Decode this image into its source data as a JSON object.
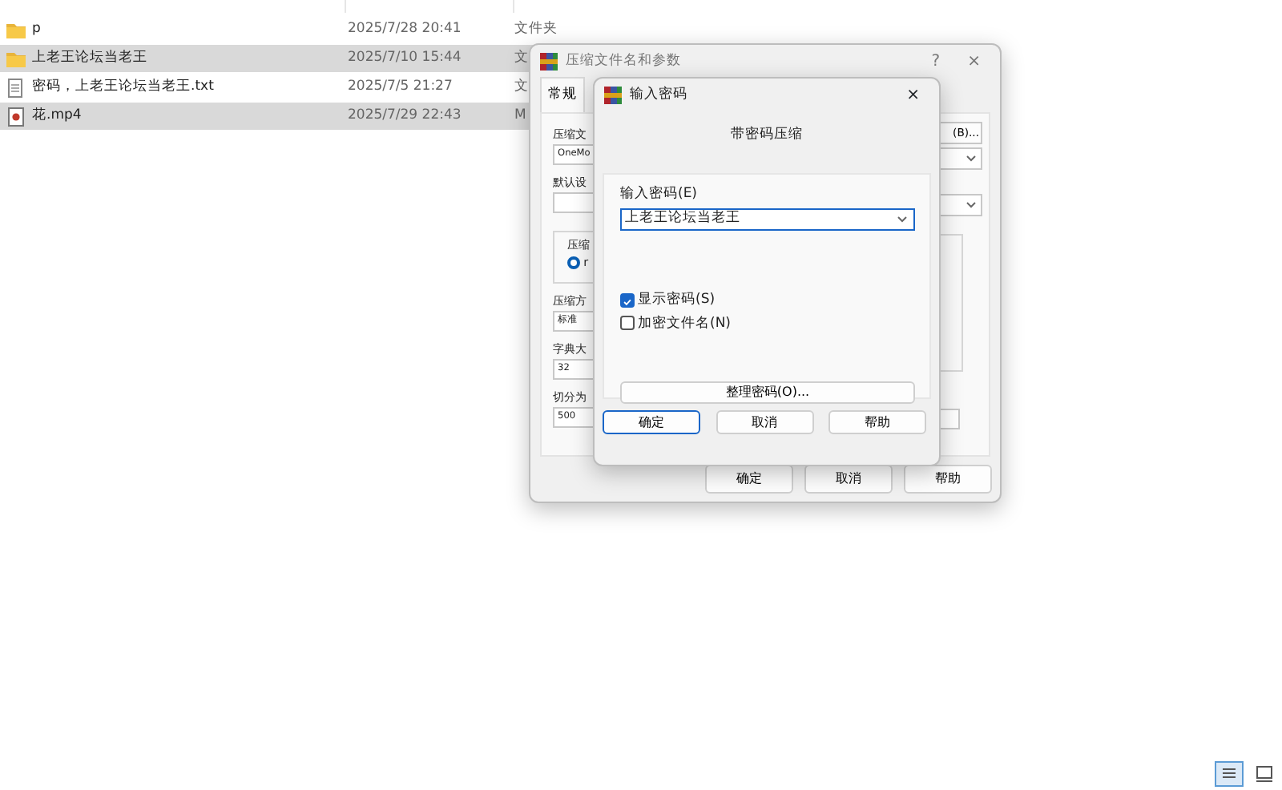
{
  "files": [
    {
      "name": "p",
      "date": "2025/7/28 20:41",
      "type": "文件夹",
      "kind": "folder",
      "selected": false
    },
    {
      "name": "上老王论坛当老王",
      "date": "2025/7/10 15:44",
      "type": "文",
      "kind": "folder",
      "selected": true
    },
    {
      "name": "密码，上老王论坛当老王.txt",
      "date": "2025/7/5 21:27",
      "type": "文",
      "kind": "text",
      "selected": false
    },
    {
      "name": "花.mp4",
      "date": "2025/7/29 22:43",
      "type": "M",
      "kind": "video",
      "selected": true
    }
  ],
  "archive_dialog": {
    "title": "压缩文件名和参数",
    "help": "?",
    "close": "×",
    "tabs": [
      {
        "label": "常规",
        "selected": true
      }
    ],
    "left": [
      {
        "kind": "label",
        "text": "压缩文"
      },
      {
        "kind": "field",
        "text": "OneMo"
      },
      {
        "kind": "label",
        "text": "默认设"
      },
      {
        "kind": "field"
      },
      {
        "kind": "group",
        "text": "压缩",
        "option": "r",
        "checked": true
      },
      {
        "kind": "label",
        "text": "压缩方"
      },
      {
        "kind": "field",
        "text": "标准"
      },
      {
        "kind": "label",
        "text": "字典大"
      },
      {
        "kind": "field",
        "text": "32"
      },
      {
        "kind": "label",
        "text": "切分为"
      },
      {
        "kind": "field",
        "text": "500"
      }
    ],
    "right": [
      {
        "kind": "button",
        "text": "(B)..."
      },
      {
        "kind": "combo"
      },
      {
        "kind": "combo"
      },
      {
        "kind": "group"
      },
      {
        "kind": "field"
      }
    ],
    "buttons": [
      {
        "label": "确定",
        "default": false
      },
      {
        "label": "取消",
        "default": false
      },
      {
        "label": "帮助",
        "default": false
      }
    ]
  },
  "password_dialog": {
    "title": "输入密码",
    "close": "×",
    "heading": "带密码压缩",
    "password_label": "输入密码(E)",
    "password_value": "上老王论坛当老王",
    "checkboxes": [
      {
        "label": "显示密码(S)",
        "checked": true
      },
      {
        "label": "加密文件名(N)",
        "checked": false
      }
    ],
    "manage_button": "整理密码(O)...",
    "buttons": [
      {
        "label": "确定",
        "default": true
      },
      {
        "label": "取消",
        "default": false
      },
      {
        "label": "帮助",
        "default": false
      }
    ]
  },
  "view_buttons": [
    {
      "kind": "details",
      "selected": true
    },
    {
      "kind": "tiles",
      "selected": false
    }
  ]
}
